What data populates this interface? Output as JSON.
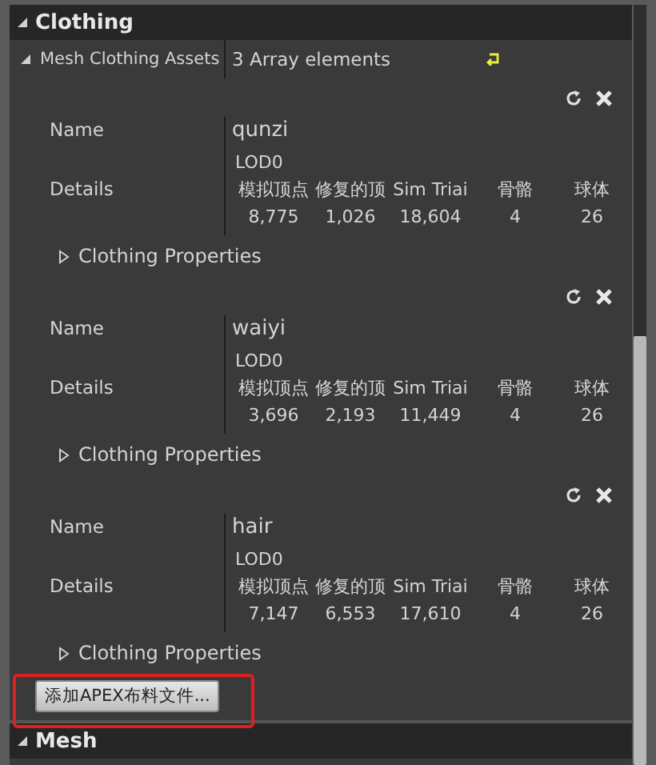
{
  "section": {
    "title": "Clothing",
    "expanded": true
  },
  "assets_property": {
    "label": "Mesh Clothing Assets",
    "value": "3 Array elements",
    "expanded": true
  },
  "assets": [
    {
      "name_label": "Name",
      "name": "qunzi",
      "details_label": "Details",
      "lod": "LOD0",
      "columns": [
        "模拟顶点",
        "修复的顶",
        "Sim Triai",
        "骨骼",
        "球体"
      ],
      "values": [
        "8,775",
        "1,026",
        "18,604",
        "4",
        "26"
      ],
      "properties": {
        "label": "Clothing Properties",
        "expanded": false
      }
    },
    {
      "name_label": "Name",
      "name": "waiyi",
      "details_label": "Details",
      "lod": "LOD0",
      "columns": [
        "模拟顶点",
        "修复的顶",
        "Sim Triai",
        "骨骼",
        "球体"
      ],
      "values": [
        "3,696",
        "2,193",
        "11,449",
        "4",
        "26"
      ],
      "properties": {
        "label": "Clothing Properties",
        "expanded": false
      }
    },
    {
      "name_label": "Name",
      "name": "hair",
      "details_label": "Details",
      "lod": "LOD0",
      "columns": [
        "模拟顶点",
        "修复的顶",
        "Sim Triai",
        "骨骼",
        "球体"
      ],
      "values": [
        "7,147",
        "6,553",
        "17,610",
        "4",
        "26"
      ],
      "properties": {
        "label": "Clothing Properties",
        "expanded": false
      }
    }
  ],
  "add_button": "添加APEX布料文件...",
  "next_section": {
    "title": "Mesh",
    "expanded": true
  }
}
